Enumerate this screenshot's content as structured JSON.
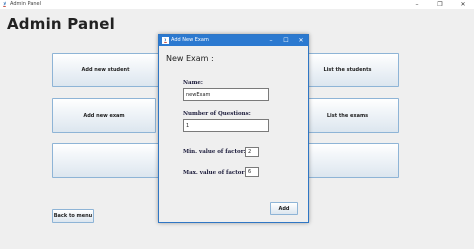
{
  "window": {
    "title": "Admin Panel",
    "controls": {
      "minimize": "–",
      "maximize": "❐",
      "close": "✕"
    }
  },
  "main": {
    "heading": "Admin Panel",
    "buttons": {
      "add_student": "Add new student",
      "list_students": "List the students",
      "add_exam": "Add new exam",
      "list_exams": "List the exams",
      "blank_left": "",
      "blank_right": "",
      "back": "Back to menu"
    }
  },
  "dialog": {
    "title": "Add New Exam",
    "controls": {
      "minimize": "–",
      "maximize": "☐",
      "close": "✕"
    },
    "heading": "New Exam :",
    "name_label": "Name:",
    "name_value": "newExam",
    "questions_label": "Number of Questions:",
    "questions_value": "1",
    "min_factor_label": "Min. value of factor:",
    "min_factor_value": "2",
    "max_factor_label": "Max. value of factor:",
    "max_factor_value": "6",
    "add_button": "Add"
  },
  "colors": {
    "dialog_titlebar": "#2b79d0",
    "button_border": "#8eb4d6",
    "background": "#efefef"
  }
}
